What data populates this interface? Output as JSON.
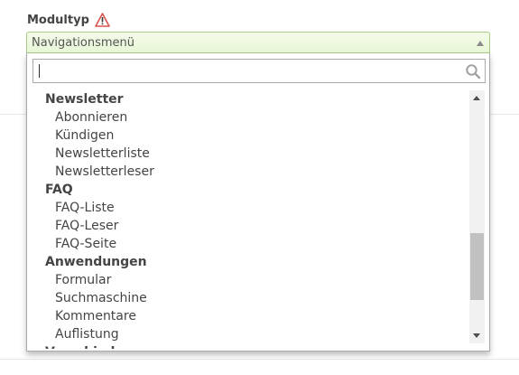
{
  "field": {
    "label": "Modultyp",
    "selected_value": "Navigationsmenü",
    "warning_color": "#d9534f",
    "accent_color": "#a9c987"
  },
  "search": {
    "value": ""
  },
  "groups": [
    {
      "label": "Newsletter",
      "options": [
        "Abonnieren",
        "Kündigen",
        "Newsletterliste",
        "Newsletterleser"
      ]
    },
    {
      "label": "FAQ",
      "options": [
        "FAQ-Liste",
        "FAQ-Leser",
        "FAQ-Seite"
      ]
    },
    {
      "label": "Anwendungen",
      "options": [
        "Formular",
        "Suchmaschine",
        "Kommentare",
        "Auflistung"
      ]
    },
    {
      "label": "Verschiedenes",
      "options": []
    }
  ],
  "icons": {
    "warning": "warning-icon",
    "search": "search-icon",
    "arrow": "chevron-up-icon"
  }
}
